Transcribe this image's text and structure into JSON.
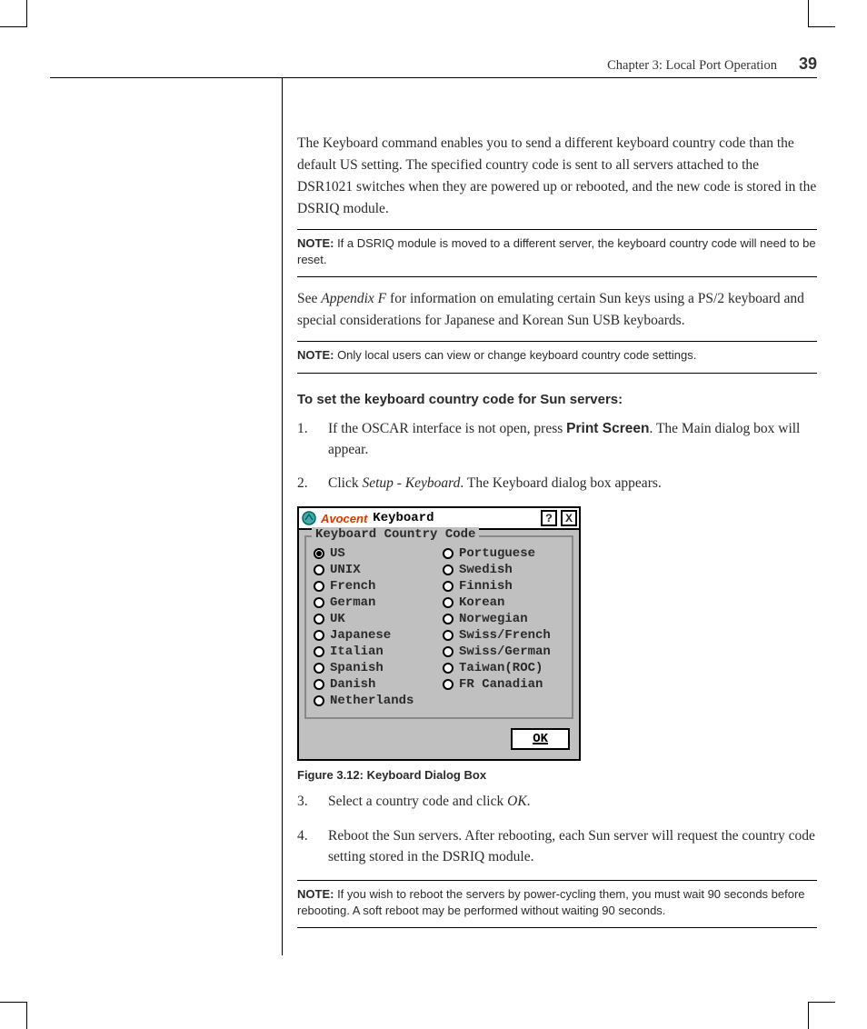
{
  "header": {
    "chapter": "Chapter 3: Local Port Operation",
    "page_number": "39"
  },
  "intro_para": "The Keyboard command enables you to send a different keyboard country code than the default US setting. The specified country code is sent to all servers attached to the DSR1021 switches when they are powered up or rebooted, and the new code is stored in the DSRIQ module.",
  "note1": {
    "label": "NOTE:",
    "text": " If a DSRIQ module is moved to a different server, the keyboard country code will need to be reset."
  },
  "para2_a": "See ",
  "para2_italic": "Appendix F",
  "para2_b": " for information on emulating certain Sun keys using a PS/2 keyboard and special considerations for Japanese and Korean Sun USB keyboards.",
  "note2": {
    "label": "NOTE:",
    "text": " Only local users can view or change keyboard country code settings."
  },
  "proc_heading": "To set the keyboard country code for Sun servers:",
  "steps": {
    "s1a": "If the OSCAR interface is not open, press ",
    "s1_bold": "Print Screen",
    "s1b": ". The Main dialog box will appear.",
    "s2a": "Click ",
    "s2_italic": "Setup - Keyboard",
    "s2b": ". The Keyboard dialog box appears.",
    "s3a": "Select a country code and click ",
    "s3_italic": "OK",
    "s3b": ".",
    "s4": "Reboot the Sun servers. After rebooting, each Sun server will request the country code setting stored in the DSRIQ module."
  },
  "dialog": {
    "brand": "Avocent",
    "title": "Keyboard",
    "help_glyph": "?",
    "close_glyph": "X",
    "group_label": "Keyboard Country Code",
    "options_left": [
      "US",
      "UNIX",
      "French",
      "German",
      "UK",
      "Japanese",
      "Italian",
      "Spanish",
      "Danish",
      "Netherlands"
    ],
    "options_right": [
      "Portuguese",
      "Swedish",
      "Finnish",
      "Korean",
      "Norwegian",
      "Swiss/French",
      "Swiss/German",
      "Taiwan(ROC)",
      "FR Canadian"
    ],
    "selected": "US",
    "ok_label": "OK"
  },
  "figure_caption": "Figure 3.12: Keyboard Dialog Box",
  "note3": {
    "label": "NOTE:",
    "text": " If you wish to reboot the servers by power-cycling them, you must wait 90 seconds before rebooting. A soft reboot may be performed without waiting 90 seconds."
  }
}
